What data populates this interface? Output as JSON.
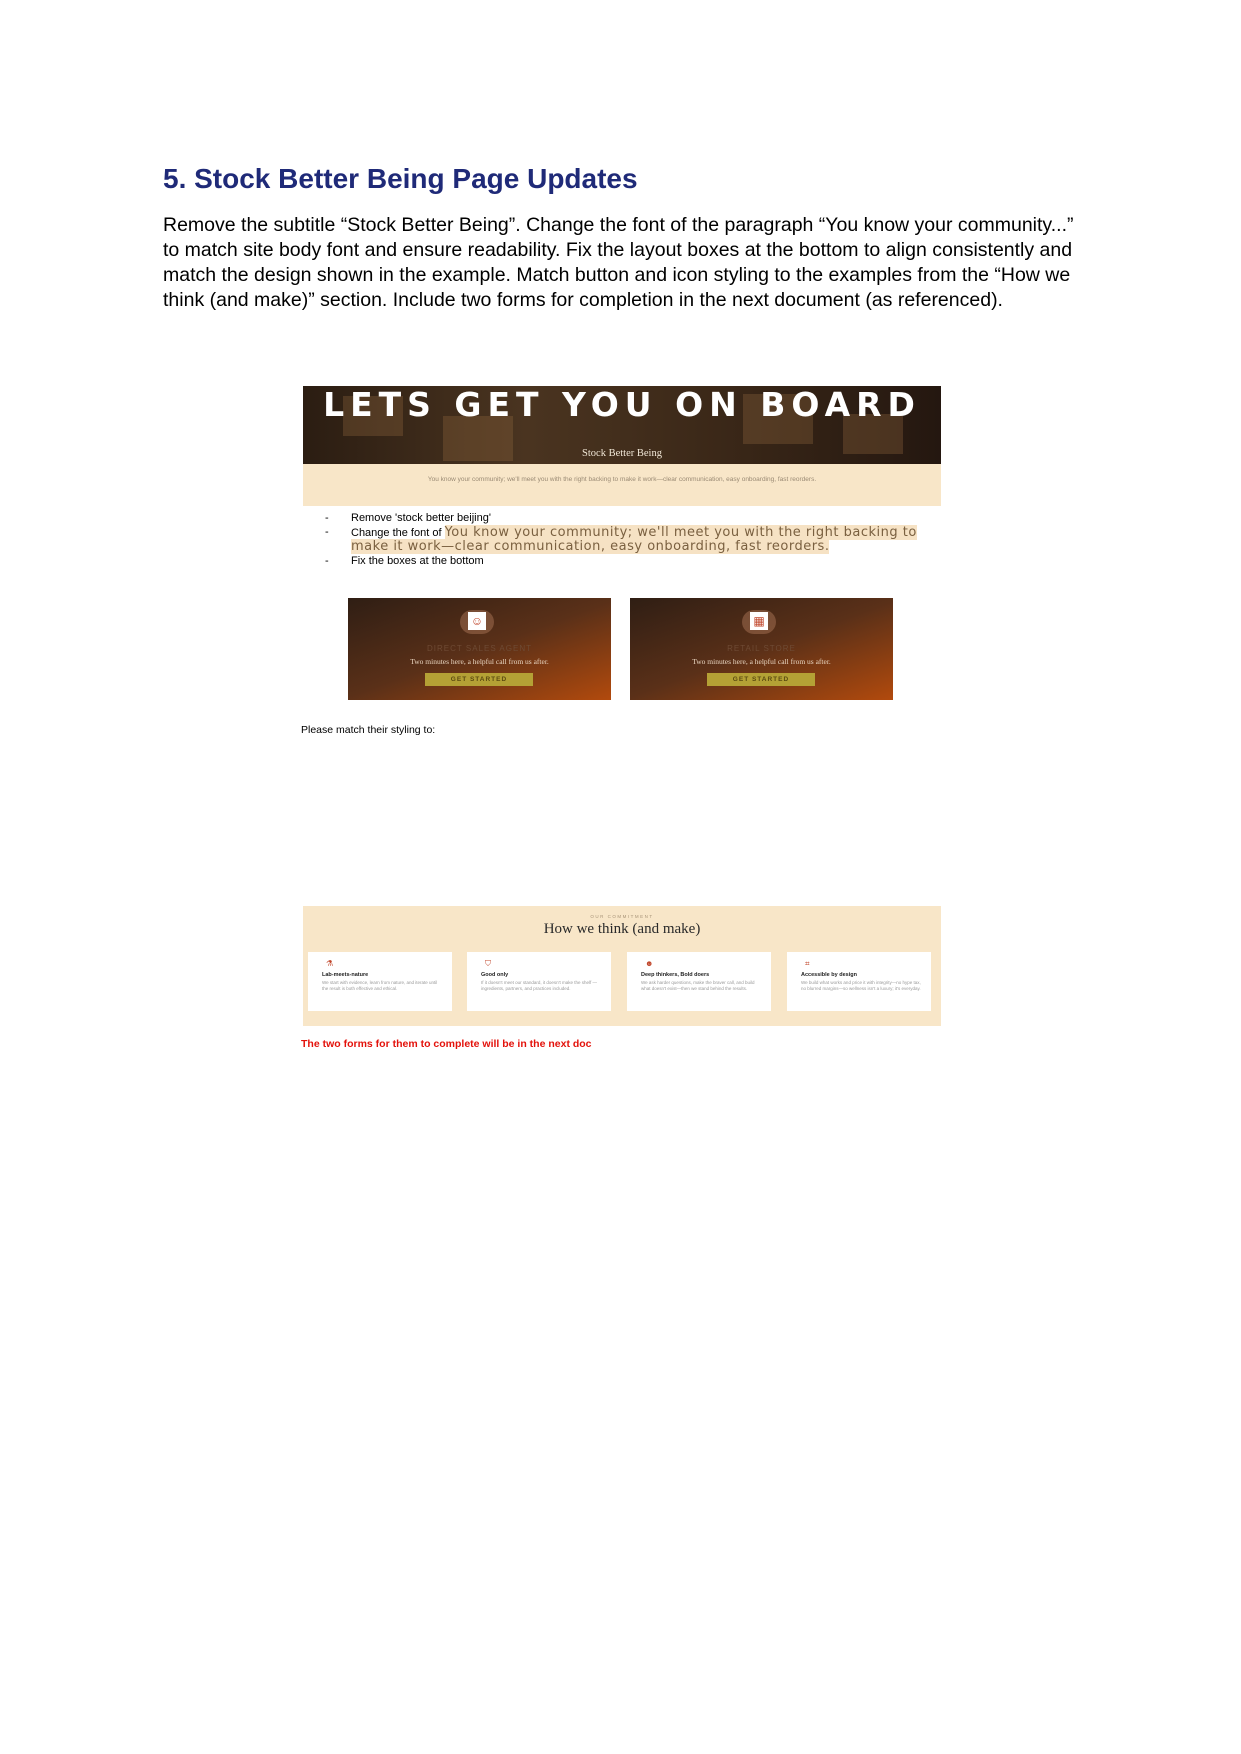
{
  "heading": "5. Stock Better Being Page Updates",
  "intro": "Remove the subtitle “Stock Better Being”. Change the font of the paragraph “You know your community...” to match site body font and ensure readability. Fix the layout boxes at the bottom to align consistently and match the design shown in the example. Match button and icon styling to the examples from the “How we think (and make)” section. Include two forms for completion in the next document (as referenced).",
  "hero": {
    "title": "LETS GET YOU ON BOARD",
    "subtitle": "Stock Better Being",
    "body": "You know your community; we'll meet you with the right backing to make it work—clear communication, easy onboarding, fast reorders."
  },
  "notes": {
    "item1": "Remove 'stock better beijing'",
    "item2_prefix": "Change the font of ",
    "item2_highlight": "You know your community; we'll meet you with the right backing to make it work—clear communication, easy onboarding, fast reorders.",
    "item3": "Fix the boxes at the bottom"
  },
  "cards": [
    {
      "icon": "agent-icon",
      "title": "DIRECT SALES AGENT",
      "desc": "Two minutes here, a helpful call from us after.",
      "button": "GET STARTED"
    },
    {
      "icon": "store-icon",
      "title": "RETAIL STORE",
      "desc": "Two minutes here, a helpful call from us after.",
      "button": "GET STARTED"
    }
  ],
  "match_text": "Please match their styling to:",
  "commitment": {
    "eyebrow": "OUR COMMITMENT",
    "title": "How we think (and make)",
    "items": [
      {
        "icon": "flask-icon",
        "title": "Lab-meets-nature",
        "body": "We start with evidence, learn from nature, and iterate until the result is both effective and ethical."
      },
      {
        "icon": "shield-icon",
        "title": "Good only",
        "body": "If it doesn't meet our standard, it doesn't make the shelf — ingredients, partners, and practices included."
      },
      {
        "icon": "head-icon",
        "title": "Deep thinkers, Bold doers",
        "body": "We ask harder questions, make the braver call, and build what doesn't exist—then we stand behind the results."
      },
      {
        "icon": "tag-icon",
        "title": "Accessible by design",
        "body": "We build what works and price it with integrity—no hype tax, no blurred margins—so wellness isn't a luxury; it's everyday."
      }
    ]
  },
  "footnote": "The two forms for them to complete will be in the next doc",
  "colors": {
    "heading": "#1f2a78",
    "footnote": "#e3120b",
    "cream": "#f8e6c8",
    "button": "#b4a135"
  }
}
